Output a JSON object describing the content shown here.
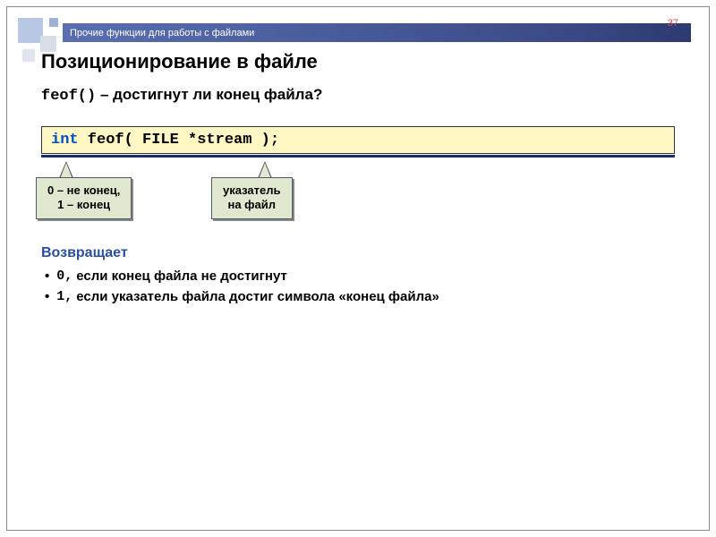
{
  "header": {
    "breadcrumb": "Прочие функции для работы с файлами",
    "page_number": "37"
  },
  "title": "Позиционирование в файле",
  "subtitle": {
    "func": "feof()",
    "sep": " – ",
    "question": "достигнут ли конец файла?"
  },
  "code": {
    "keyword": "int",
    "rest": " feof( FILE *stream );"
  },
  "callouts": {
    "c1_line1": "0 – не конец,",
    "c1_line2": "1 – конец",
    "c2_line1": "указатель",
    "c2_line2": "на файл"
  },
  "returns": {
    "heading": "Возвращает",
    "items": [
      {
        "code": "0,",
        "text": " если конец файла не достигнут"
      },
      {
        "code": "1,",
        "text": "если указатель файла достиг символа «конец файла»"
      }
    ]
  }
}
